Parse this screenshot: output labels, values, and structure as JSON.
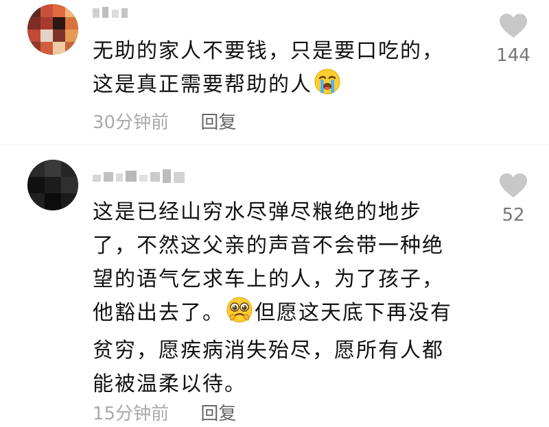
{
  "comments": [
    {
      "avatar": "pixelated-avatar",
      "username": "",
      "text_lines": [
        "无助的家人不要钱，只是要口吃的，",
        "这是真正需要帮助的人"
      ],
      "emoji": "crying-face-icon",
      "time": "30分钟前",
      "reply_label": "回复",
      "likes": "144"
    },
    {
      "avatar": "pixelated-avatar",
      "username": "",
      "text_lines": [
        "这是已经山穷水尽弹尽粮绝的地步",
        "了，不然这父亲的声音不会带一种绝",
        "望的语气乞求车上的人，为了孩子，",
        "他豁出去了。",
        "但愿这天底下再没有",
        "贫穷，愿疾病消失殆尽，愿所有人都",
        "能被温柔以待。"
      ],
      "emoji": "pleading-face-icon",
      "time": "15分钟前",
      "reply_label": "回复",
      "likes": "52"
    }
  ],
  "colors": {
    "meta_text": "#a9a9a9",
    "reply_text": "#666666",
    "like_icon": "#c8c8c8",
    "like_count": "#777777"
  }
}
